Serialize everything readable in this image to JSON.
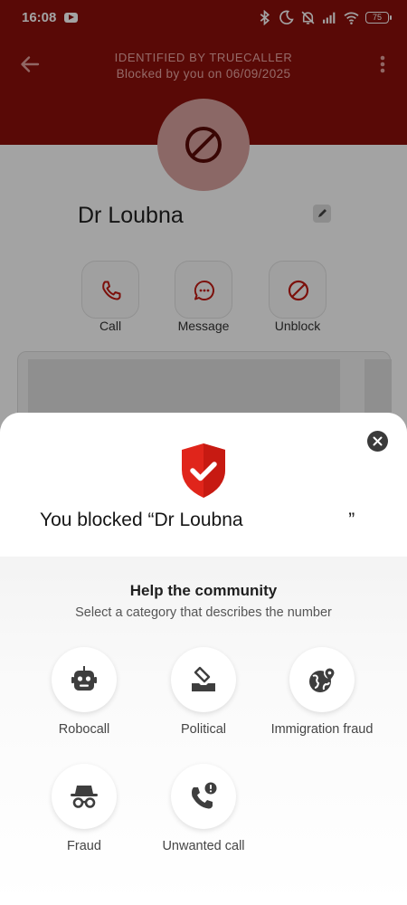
{
  "status_bar": {
    "time": "16:08",
    "battery": "75"
  },
  "header": {
    "identified_label": "IDENTIFIED BY TRUECALLER",
    "blocked_info": "Blocked by you on 06/09/2025"
  },
  "contact": {
    "name": "Dr Loubna"
  },
  "actions": [
    {
      "label": "Call",
      "icon": "phone-icon"
    },
    {
      "label": "Message",
      "icon": "message-icon"
    },
    {
      "label": "Unblock",
      "icon": "block-icon"
    }
  ],
  "sheet": {
    "title": "You blocked “Dr Loubna                    ”",
    "help_title": "Help the community",
    "help_subtitle": "Select a category that describes the number",
    "categories": [
      {
        "label": "Robocall",
        "icon": "robot-icon"
      },
      {
        "label": "Political",
        "icon": "ballot-box-icon"
      },
      {
        "label": "Immigration fraud",
        "icon": "globe-pin-icon"
      },
      {
        "label": "Fraud",
        "icon": "spy-icon"
      },
      {
        "label": "Unwanted call",
        "icon": "phone-alert-icon"
      }
    ]
  },
  "colors": {
    "header_red": "#8b0f0a",
    "shield_red": "#e0251b",
    "dim_overlay": "rgba(0,0,0,0.36)"
  }
}
